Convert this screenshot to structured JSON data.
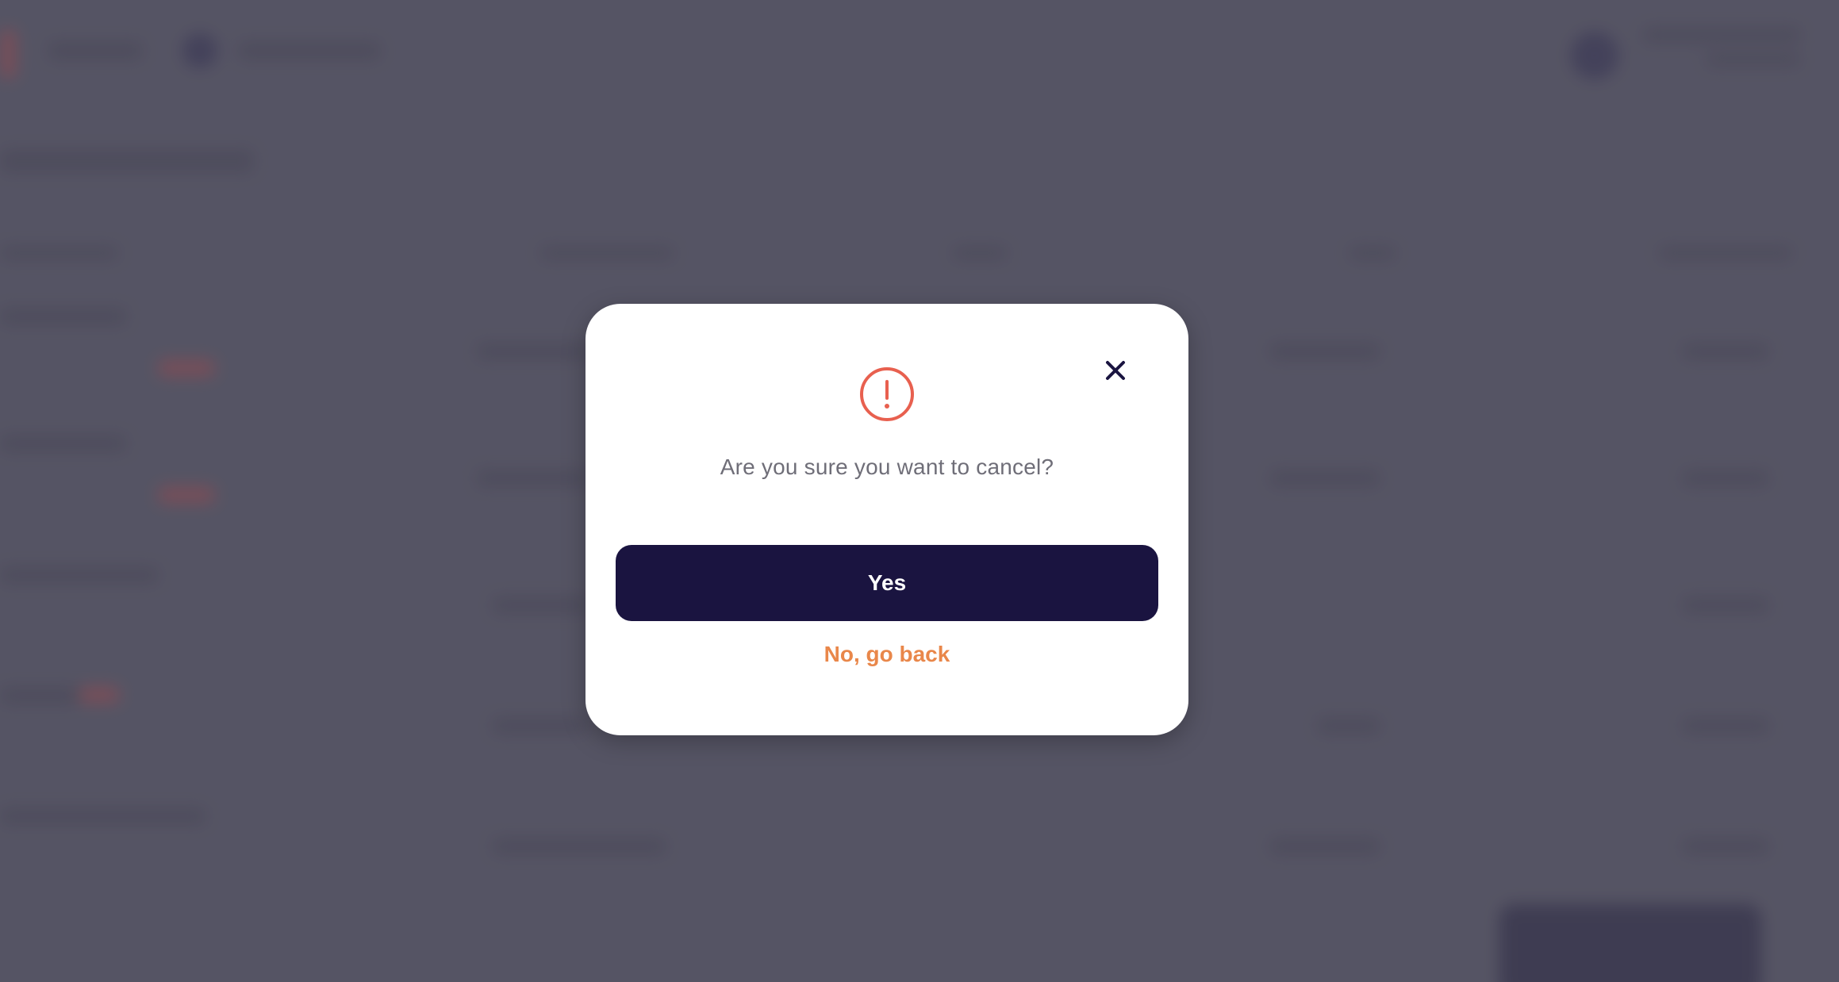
{
  "dialog": {
    "question": "Are you sure you want to cancel?",
    "confirm_label": "Yes",
    "back_label": "No, go back",
    "close_icon": "close-icon",
    "warning_icon": "exclamation-circle-icon"
  },
  "colors": {
    "primary": "#1a1440",
    "accent": "#e9874a",
    "warning": "#e8604f",
    "backdrop": "#5f5d6c"
  }
}
